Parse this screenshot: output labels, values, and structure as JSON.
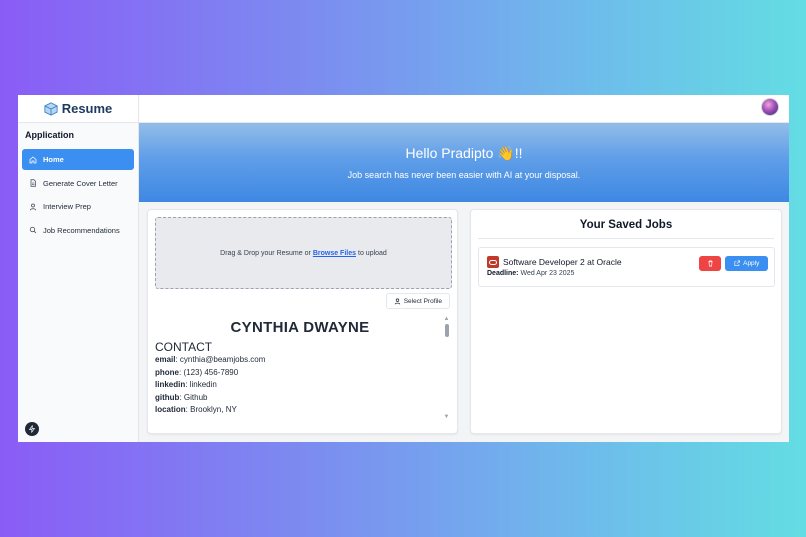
{
  "brand": {
    "name": "Resume"
  },
  "sidebar": {
    "section_title": "Application",
    "items": [
      {
        "label": "Home",
        "icon": "home-icon",
        "active": true
      },
      {
        "label": "Generate Cover Letter",
        "icon": "document-icon",
        "active": false
      },
      {
        "label": "Interview Prep",
        "icon": "user-icon",
        "active": false
      },
      {
        "label": "Job Recommendations",
        "icon": "search-icon",
        "active": false
      }
    ]
  },
  "hero": {
    "title": "Hello Pradipto 👋!!",
    "subtitle": "Job search has never been easier with AI at your disposal."
  },
  "upload": {
    "text_before": "Drag & Drop your Resume or",
    "link": "Browse Files",
    "text_after": "to upload",
    "select_profile_label": "Select Profile"
  },
  "resume": {
    "name": "CYNTHIA DWAYNE",
    "section": "CONTACT",
    "contact": [
      {
        "key": "email",
        "value": "cynthia@beamjobs.com"
      },
      {
        "key": "phone",
        "value": "(123) 456-7890"
      },
      {
        "key": "linkedin",
        "value": "linkedin"
      },
      {
        "key": "github",
        "value": "Github"
      },
      {
        "key": "location",
        "value": "Brooklyn, NY"
      }
    ]
  },
  "saved_jobs": {
    "title": "Your Saved Jobs",
    "jobs": [
      {
        "title": "Software Developer 2 at Oracle",
        "deadline_label": "Deadline:",
        "deadline": "Wed Apr 23 2025",
        "apply_label": "Apply"
      }
    ]
  },
  "colors": {
    "accent": "#3b8ff0",
    "danger": "#ef4444",
    "oracle": "#c0392b"
  }
}
